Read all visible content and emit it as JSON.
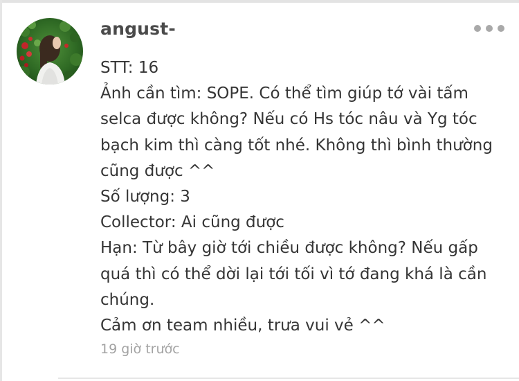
{
  "comment": {
    "username": "angust-",
    "avatar_icon": "profile-photo",
    "more_icon": "more-horizontal-icon",
    "lines": [
      "STT: 16",
      "Ảnh cần tìm: SOPE. Có thể tìm giúp tớ vài tấm",
      "selca được không? Nếu có Hs tóc nâu và Yg tóc",
      "bạch kim thì càng tốt nhé. Không thì bình thường",
      "cũng được ^^",
      "Số lượng: 3",
      "Collector: Ai cũng được",
      "Hạn: Từ bây giờ tới chiều được không? Nếu gấp",
      "quá thì có thể dời lại tới tối vì tớ đang khá là cần",
      "chúng.",
      "Cảm ơn team nhiều, trưa vui vẻ ^^"
    ],
    "timestamp": "19 giờ trước"
  },
  "colors": {
    "username": "#4a4a4a",
    "body_text": "#353535",
    "meta_text": "#a3a3a3",
    "dots": "#a9a9a9",
    "divider": "#e6e6e6"
  }
}
